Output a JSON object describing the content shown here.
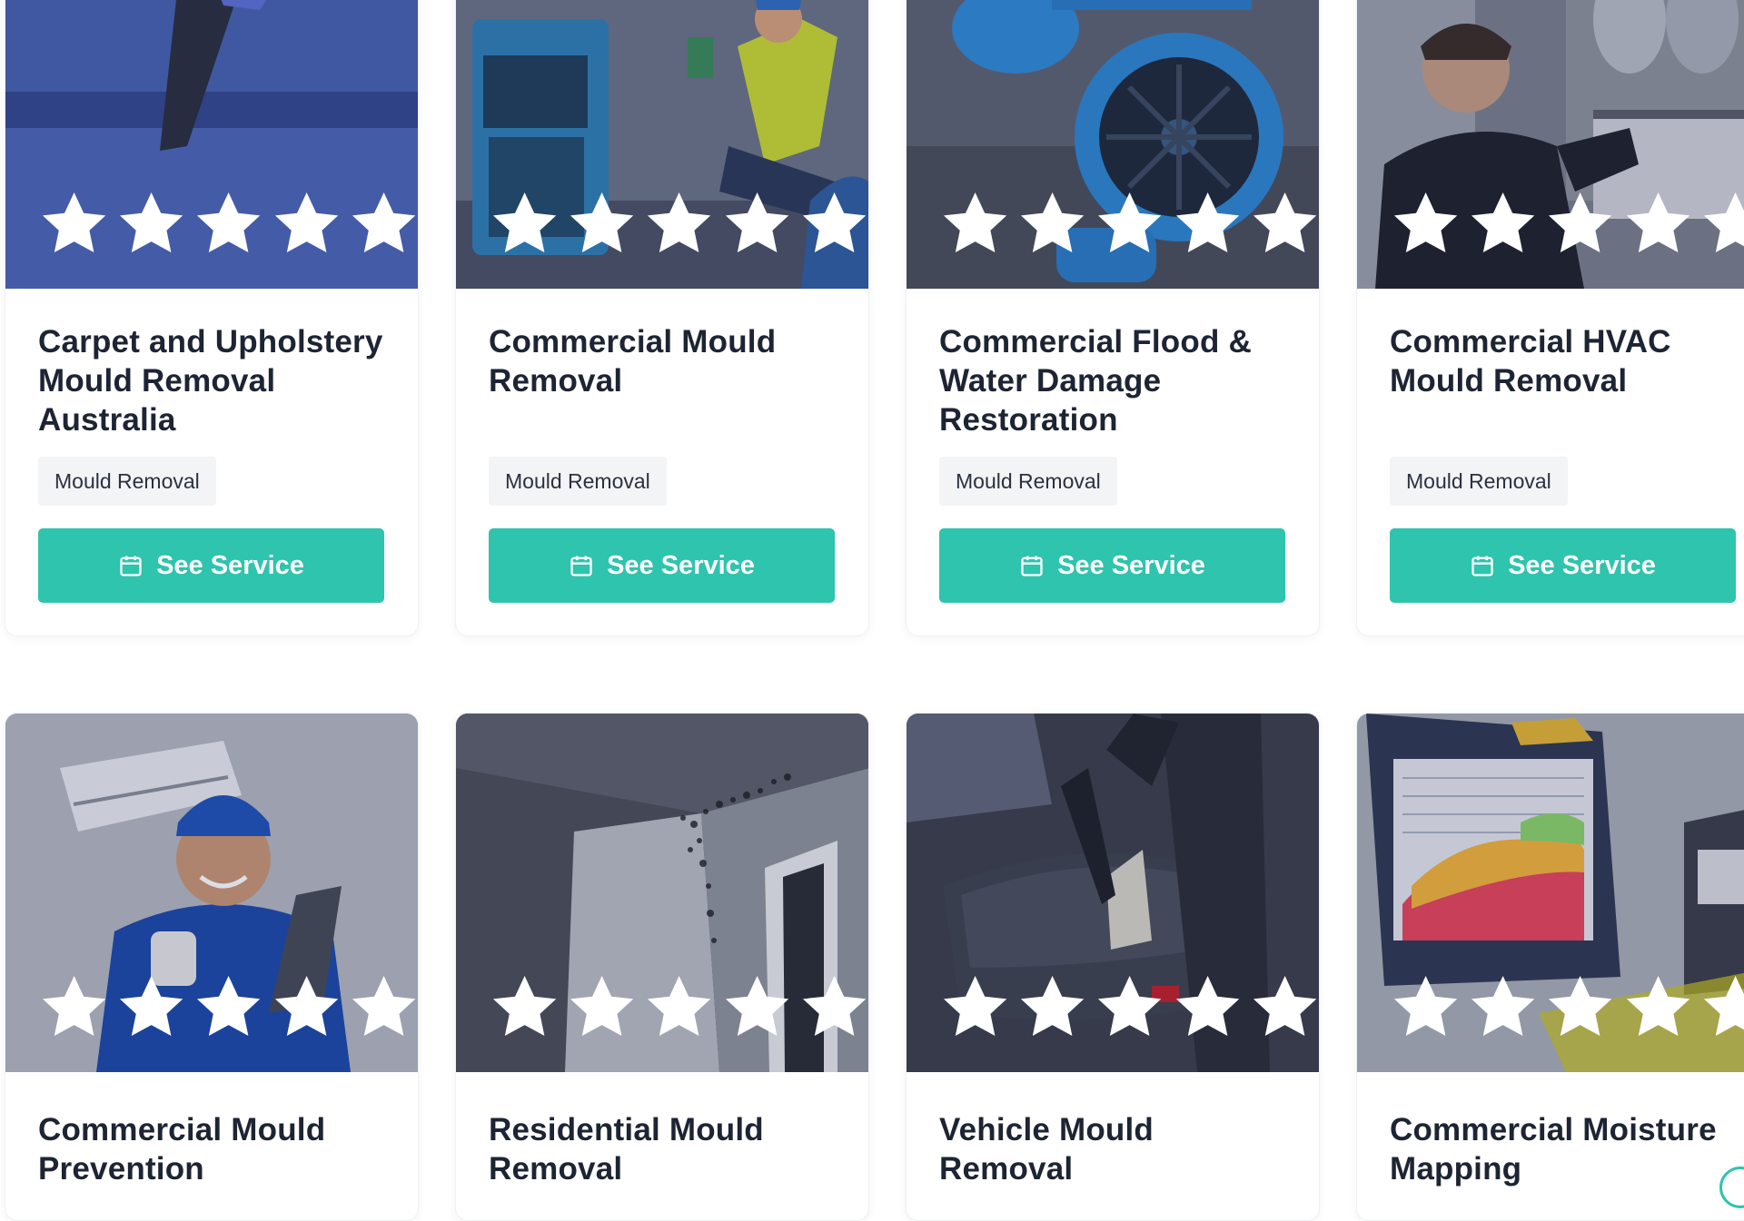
{
  "colors": {
    "accent": "#2ec4ad",
    "title": "#1d2433",
    "tag_bg": "#f3f4f6",
    "star": "#ffffff"
  },
  "rating": {
    "value": 5,
    "max": 5
  },
  "cards": [
    {
      "title": "Carpet and Upholstery Mould Removal Australia",
      "category": "Mould Removal",
      "button": "See Service",
      "image": "blue-sofa-carpet-cleaning-photo"
    },
    {
      "title": "Commercial Mould Removal",
      "category": "Mould Removal",
      "button": "See Service",
      "image": "technician-with-dehumidifier-photo"
    },
    {
      "title": "Commercial Flood & Water Damage Restoration",
      "category": "Mould Removal",
      "button": "See Service",
      "image": "blue-air-mover-fan-photo"
    },
    {
      "title": "Commercial HVAC Mould Removal",
      "category": "Mould Removal",
      "button": "See Service",
      "image": "technician-servicing-hvac-photo"
    },
    {
      "title": "Commercial Mould Prevention",
      "image": "smiling-technician-with-tablet-photo"
    },
    {
      "title": "Residential Mould Removal",
      "image": "mould-on-wall-corner-photo"
    },
    {
      "title": "Vehicle Mould Removal",
      "image": "car-seat-extraction-photo"
    },
    {
      "title": "Commercial Moisture Mapping",
      "image": "tablet-moisture-map-photo"
    }
  ]
}
